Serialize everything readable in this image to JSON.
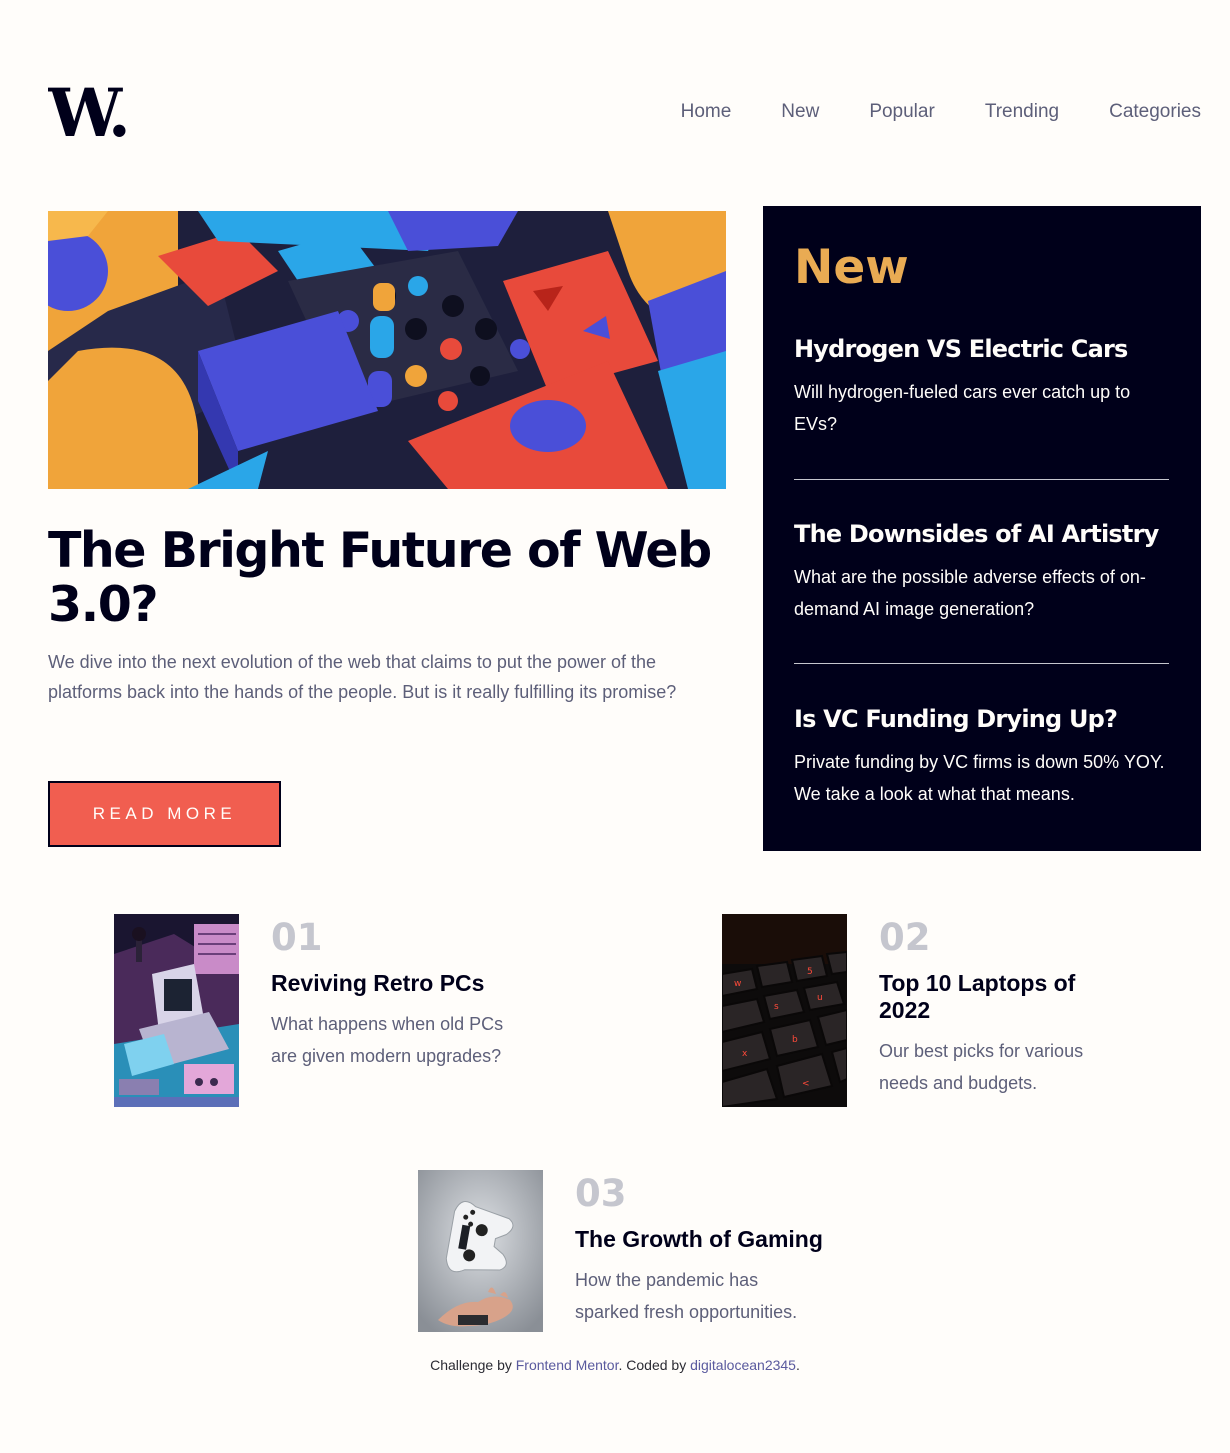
{
  "header": {
    "logo_text": "W.",
    "nav": [
      "Home",
      "New",
      "Popular",
      "Trending",
      "Categories"
    ]
  },
  "hero": {
    "title": "The Bright Future of Web 3.0?",
    "description": "We dive into the next evolution of the web that claims to put the power of the platforms back into the hands of the people. But is it really fulfilling its promise?",
    "button_label": "READ MORE"
  },
  "new_panel": {
    "heading": "New",
    "items": [
      {
        "title": "Hydrogen VS Electric Cars",
        "description": "Will hydrogen-fueled cars ever catch up to EVs?"
      },
      {
        "title": "The Downsides of AI Artistry",
        "description": "What are the possible adverse effects of on-demand AI image generation?"
      },
      {
        "title": "Is VC Funding Drying Up?",
        "description": "Private funding by VC firms is down 50% YOY. We take a look at what that means."
      }
    ]
  },
  "ranked": [
    {
      "number": "01",
      "title": "Reviving Retro PCs",
      "description": "What happens when old PCs are given modern upgrades?"
    },
    {
      "number": "02",
      "title": "Top 10 Laptops of 2022",
      "description": "Our best picks for various needs and budgets."
    },
    {
      "number": "03",
      "title": "The Growth of Gaming",
      "description": "How the pandemic has sparked fresh opportunities."
    }
  ],
  "footer": {
    "prefix": "Challenge by ",
    "link1": "Frontend Mentor",
    "middle": ". Coded by ",
    "link2": "digitalocean2345",
    "suffix": "."
  },
  "colors": {
    "background": "#fffdfa",
    "dark": "#00001a",
    "accent_red": "#f15e50",
    "accent_orange": "#e9ab53",
    "grey_blue": "#5d5f79",
    "grey": "#c5c6ce"
  }
}
